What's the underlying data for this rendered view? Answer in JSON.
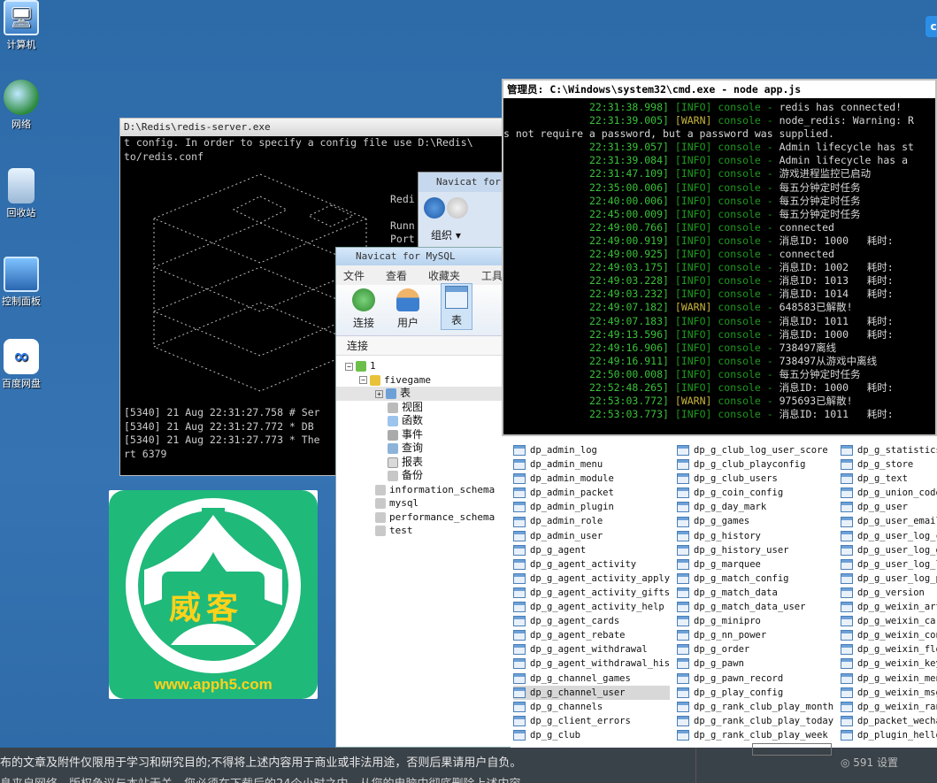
{
  "desktop_icons": [
    {
      "label": "计算机",
      "icon": "computer-icon"
    },
    {
      "label": "网络",
      "icon": "network-icon"
    },
    {
      "label": "回收站",
      "icon": "recycle-bin-icon"
    },
    {
      "label": "控制面板",
      "icon": "control-panel-icon"
    },
    {
      "label": "百度网盘",
      "icon": "baidu-netdisk-icon"
    }
  ],
  "redis_window": {
    "title": "D:\\Redis\\redis-server.exe",
    "lines": [
      "t config. In order to specify a config file use D:\\Redis\\",
      "to/redis.conf"
    ],
    "side_lines": [
      "Redi",
      "",
      "Runn",
      "Port"
    ],
    "logs": [
      "[5340] 21 Aug 22:31:27.758 # Ser",
      "[5340] 21 Aug 22:31:27.772 * DB ",
      "[5340] 21 Aug 22:31:27.773 * The",
      "rt 6379"
    ]
  },
  "explorer_window": {
    "title": "Navicat for",
    "organize_label": "组织 ▾"
  },
  "navicat": {
    "title": "Navicat for MySQL",
    "menu": [
      "文件",
      "查看",
      "收藏夹",
      "工具"
    ],
    "tools": [
      {
        "label": "连接",
        "icon": "connection-icon"
      },
      {
        "label": "用户",
        "icon": "user-icon"
      },
      {
        "label": "表",
        "icon": "table-icon"
      }
    ],
    "connection_header": "连接",
    "tree": {
      "root": "1",
      "database": "fivegame",
      "children": [
        "表",
        "视图",
        "函数",
        "事件",
        "查询",
        "报表",
        "备份"
      ],
      "other_databases": [
        "information_schema",
        "mysql",
        "performance_schema",
        "test"
      ]
    }
  },
  "cmd_window": {
    "title": "管理员: C:\\Windows\\system32\\cmd.exe - node  app.js",
    "lines": [
      {
        "ts": "22:31:38.998]",
        "lvl": "[INFO]",
        "src": "console",
        "msg": "redis has connected!"
      },
      {
        "ts": "22:31:39.005]",
        "lvl": "[WARN]",
        "src": "console",
        "msg": "node_redis: Warning: R"
      },
      {
        "raw": "s not require a password, but a password was supplied."
      },
      {
        "ts": "22:31:39.057]",
        "lvl": "[INFO]",
        "src": "console",
        "msg": "Admin lifecycle has st"
      },
      {
        "ts": "22:31:39.084]",
        "lvl": "[INFO]",
        "src": "console",
        "msg": "Admin lifecycle has a"
      },
      {
        "ts": "22:31:47.109]",
        "lvl": "[INFO]",
        "src": "console",
        "msg": "游戏进程监控已启动"
      },
      {
        "ts": "22:35:00.006]",
        "lvl": "[INFO]",
        "src": "console",
        "msg": "每五分钟定时任务"
      },
      {
        "ts": "22:40:00.006]",
        "lvl": "[INFO]",
        "src": "console",
        "msg": "每五分钟定时任务"
      },
      {
        "ts": "22:45:00.009]",
        "lvl": "[INFO]",
        "src": "console",
        "msg": "每五分钟定时任务"
      },
      {
        "ts": "22:49:00.766]",
        "lvl": "[INFO]",
        "src": "console",
        "msg": "connected"
      },
      {
        "ts": "22:49:00.919]",
        "lvl": "[INFO]",
        "src": "console",
        "msg": "消息ID: 1000   耗时: "
      },
      {
        "ts": "22:49:00.925]",
        "lvl": "[INFO]",
        "src": "console",
        "msg": "connected"
      },
      {
        "ts": "22:49:03.175]",
        "lvl": "[INFO]",
        "src": "console",
        "msg": "消息ID: 1002   耗时: "
      },
      {
        "ts": "22:49:03.228]",
        "lvl": "[INFO]",
        "src": "console",
        "msg": "消息ID: 1013   耗时: "
      },
      {
        "ts": "22:49:03.232]",
        "lvl": "[INFO]",
        "src": "console",
        "msg": "消息ID: 1014   耗时: "
      },
      {
        "ts": "22:49:07.182]",
        "lvl": "[WARN]",
        "src": "console",
        "msg": "648583已解散!"
      },
      {
        "ts": "22:49:07.183]",
        "lvl": "[INFO]",
        "src": "console",
        "msg": "消息ID: 1011   耗时: "
      },
      {
        "ts": "22:49:13.596]",
        "lvl": "[INFO]",
        "src": "console",
        "msg": "消息ID: 1000   耗时: "
      },
      {
        "ts": "22:49:16.906]",
        "lvl": "[INFO]",
        "src": "console",
        "msg": "738497离线"
      },
      {
        "ts": "22:49:16.911]",
        "lvl": "[INFO]",
        "src": "console",
        "msg": "738497从游戏中离线"
      },
      {
        "ts": "22:50:00.008]",
        "lvl": "[INFO]",
        "src": "console",
        "msg": "每五分钟定时任务"
      },
      {
        "ts": "22:52:48.265]",
        "lvl": "[INFO]",
        "src": "console",
        "msg": "消息ID: 1000   耗时: "
      },
      {
        "ts": "22:53:03.772]",
        "lvl": "[WARN]",
        "src": "console",
        "msg": "975693已解散!"
      },
      {
        "ts": "22:53:03.773]",
        "lvl": "[INFO]",
        "src": "console",
        "msg": "消息ID: 1011   耗时: "
      }
    ]
  },
  "table_list": {
    "col1": [
      "dp_admin_log",
      "dp_admin_menu",
      "dp_admin_module",
      "dp_admin_packet",
      "dp_admin_plugin",
      "dp_admin_role",
      "dp_admin_user",
      "dp_g_agent",
      "dp_g_agent_activity",
      "dp_g_agent_activity_apply",
      "dp_g_agent_activity_gifts",
      "dp_g_agent_activity_help",
      "dp_g_agent_cards",
      "dp_g_agent_rebate",
      "dp_g_agent_withdrawal",
      "dp_g_agent_withdrawal_his",
      "dp_g_channel_games",
      "dp_g_channel_user",
      "dp_g_channels",
      "dp_g_client_errors",
      "dp_g_club"
    ],
    "col2": [
      "dp_g_club_log_user_score",
      "dp_g_club_playconfig",
      "dp_g_club_users",
      "dp_g_coin_config",
      "dp_g_day_mark",
      "dp_g_games",
      "dp_g_history",
      "dp_g_history_user",
      "dp_g_marquee",
      "dp_g_match_config",
      "dp_g_match_data",
      "dp_g_match_data_user",
      "dp_g_minipro",
      "dp_g_nn_power",
      "dp_g_order",
      "dp_g_pawn",
      "dp_g_pawn_record",
      "dp_g_play_config",
      "dp_g_rank_club_play_month",
      "dp_g_rank_club_play_today",
      "dp_g_rank_club_play_week"
    ],
    "col3": [
      "dp_g_statistics_",
      "dp_g_store",
      "dp_g_text",
      "dp_g_union_code",
      "dp_g_user",
      "dp_g_user_email",
      "dp_g_user_log_co",
      "dp_g_user_log_ge",
      "dp_g_user_log_lo",
      "dp_g_user_log_pl",
      "dp_g_version",
      "dp_g_weixin_arti",
      "dp_g_weixin_care",
      "dp_g_weixin_conf",
      "dp_g_weixin_floc",
      "dp_g_weixin_keys",
      "dp_g_weixin_menu",
      "dp_g_weixin_msg",
      "dp_g_weixin_ran",
      "dp_packet_wechat",
      "dp_plugin_hello"
    ],
    "selected": "dp_g_channel_user"
  },
  "weike_logo": {
    "name": "威客",
    "url": "www.apph5.com",
    "color_green": "#1fb97a",
    "color_yellow": "#ffd21a"
  },
  "notice": {
    "line1": "布的文章及附件仅限用于学习和研究目的;不得将上述内容用于商业或非法用途，否则后果请用户自负。",
    "line2": "息来自网络，版权争议与本站无关。您必须在下载后的24个小时之内，从您的电脑中彻底删除上述内容。",
    "views": "◎ 591  设置"
  },
  "corner_badge": "c"
}
